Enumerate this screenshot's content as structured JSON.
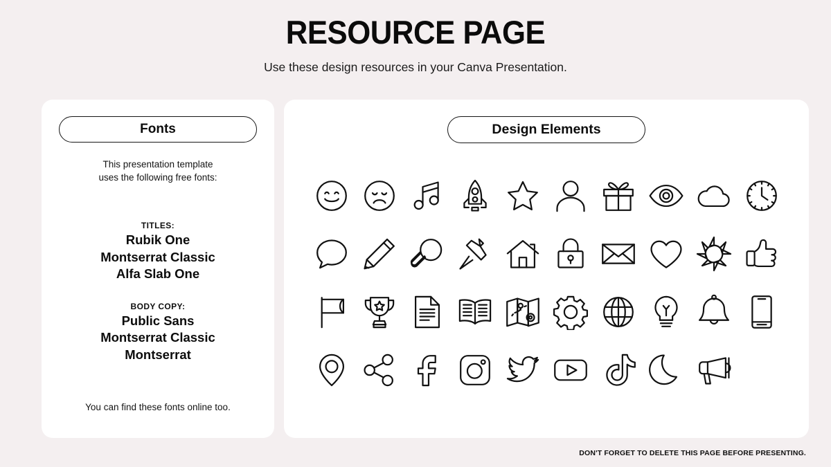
{
  "header": {
    "title": "RESOURCE PAGE",
    "subtitle": "Use these design resources in your Canva Presentation."
  },
  "colors": {
    "background": "#F4EFF0",
    "panel": "#FFFFFF",
    "ink": "#111111"
  },
  "fonts_panel": {
    "pill_label": "Fonts",
    "intro_line1": "This presentation template",
    "intro_line2": "uses the following free fonts:",
    "titles_label": "TITLES:",
    "titles_fonts": [
      "Rubik One",
      "Montserrat Classic",
      "Alfa Slab One"
    ],
    "body_label": "BODY COPY:",
    "body_fonts": [
      "Public Sans",
      "Montserrat Classic",
      "Montserrat"
    ],
    "footnote": "You can find these fonts online too."
  },
  "elements_panel": {
    "pill_label": "Design Elements",
    "icons": [
      "smiley-face-icon",
      "sad-face-icon",
      "music-note-icon",
      "rocket-icon",
      "star-icon",
      "user-icon",
      "gift-icon",
      "eye-icon",
      "cloud-icon",
      "clock-icon",
      "speech-bubble-icon",
      "pencil-icon",
      "magnifier-icon",
      "pushpin-icon",
      "house-icon",
      "lock-icon",
      "envelope-icon",
      "heart-icon",
      "sun-icon",
      "thumbs-up-icon",
      "flag-icon",
      "trophy-icon",
      "document-icon",
      "open-book-icon",
      "map-icon",
      "gear-icon",
      "globe-icon",
      "lightbulb-icon",
      "bell-icon",
      "phone-icon",
      "location-pin-icon",
      "share-icon",
      "facebook-icon",
      "instagram-icon",
      "twitter-icon",
      "youtube-icon",
      "tiktok-icon",
      "moon-icon",
      "megaphone-icon"
    ]
  },
  "footer": {
    "note": "DON'T FORGET TO DELETE THIS PAGE BEFORE PRESENTING."
  }
}
